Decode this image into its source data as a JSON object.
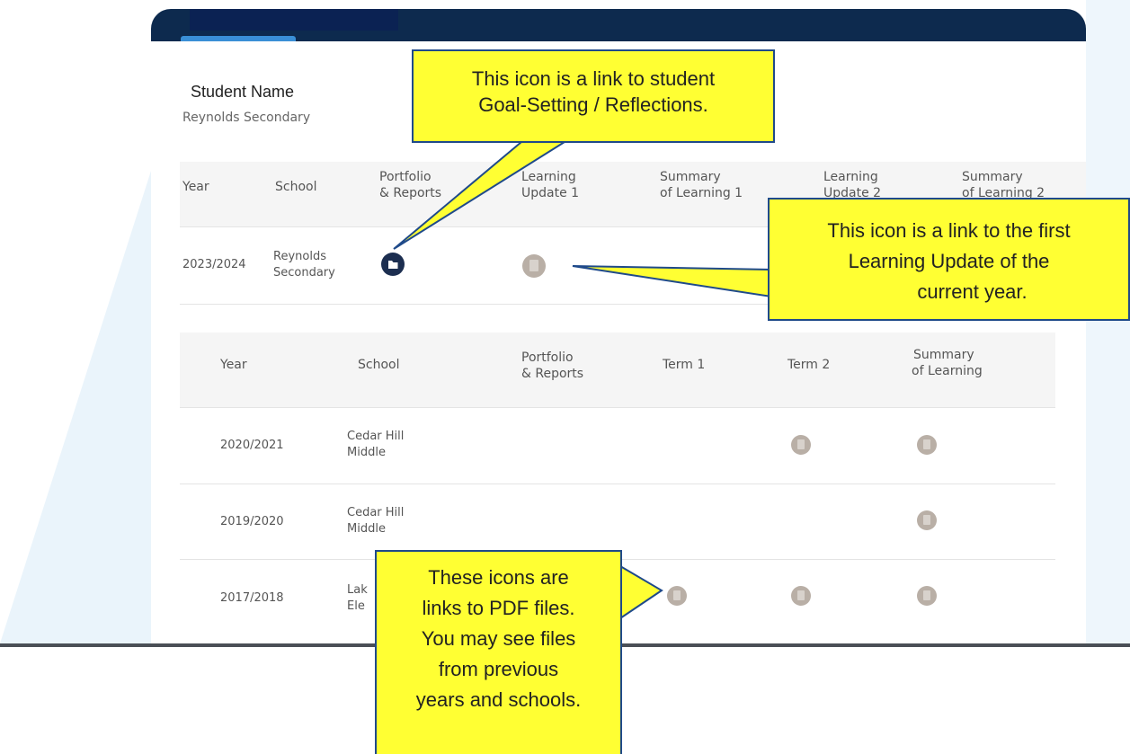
{
  "student": {
    "name": "Student Name",
    "school": "Reynolds Secondary"
  },
  "current_table": {
    "headers": {
      "year": "Year",
      "school": "School",
      "portfolio_l1": "Portfolio",
      "portfolio_l2": "& Reports",
      "lu1_l1": "Learning",
      "lu1_l2": "Update 1",
      "sol1_l1": "Summary",
      "sol1_l2": "of Learning 1",
      "lu2_l1": "Learning",
      "lu2_l2": "Update 2",
      "sol2_l1": "Summary",
      "sol2_l2": "of Learning 2"
    },
    "row": {
      "year": "2023/2024",
      "school_l1": "Reynolds",
      "school_l2": "Secondary",
      "portfolio_icon": "folder-icon",
      "lu1_icon": "document-icon"
    }
  },
  "history_table": {
    "headers": {
      "year": "Year",
      "school": "School",
      "portfolio_l1": "Portfolio",
      "portfolio_l2": "& Reports",
      "term1": "Term 1",
      "term2": "Term 2",
      "sol_l1": "Summary",
      "sol_l2": "of Learning"
    },
    "rows": [
      {
        "year": "2020/2021",
        "school_l1": "Cedar Hill",
        "school_l2": "Middle",
        "icons": [
          "term2",
          "summary"
        ]
      },
      {
        "year": "2019/2020",
        "school_l1": "Cedar Hill",
        "school_l2": "Middle",
        "icons": [
          "summary"
        ]
      },
      {
        "year": "2017/2018",
        "school_l1": "Lak",
        "school_l2": "Ele",
        "icons": [
          "term1",
          "term2",
          "summary"
        ]
      }
    ]
  },
  "callouts": {
    "goal_setting": [
      "This icon is a link to student",
      "Goal-Setting / Reflections."
    ],
    "learning_update": [
      "This icon is a link to the first",
      "Learning Update of the",
      "current year."
    ],
    "pdf_files": [
      "These icons are",
      "links to PDF files.",
      "You may see files",
      "from previous",
      "years and schools."
    ]
  },
  "colors": {
    "header_navy": "#0d2a4e",
    "callout_yellow": "#ffff33",
    "callout_border": "#1f4a8a",
    "pdf_icon": "#b9afa6",
    "portfolio_icon": "#1c2e50"
  }
}
